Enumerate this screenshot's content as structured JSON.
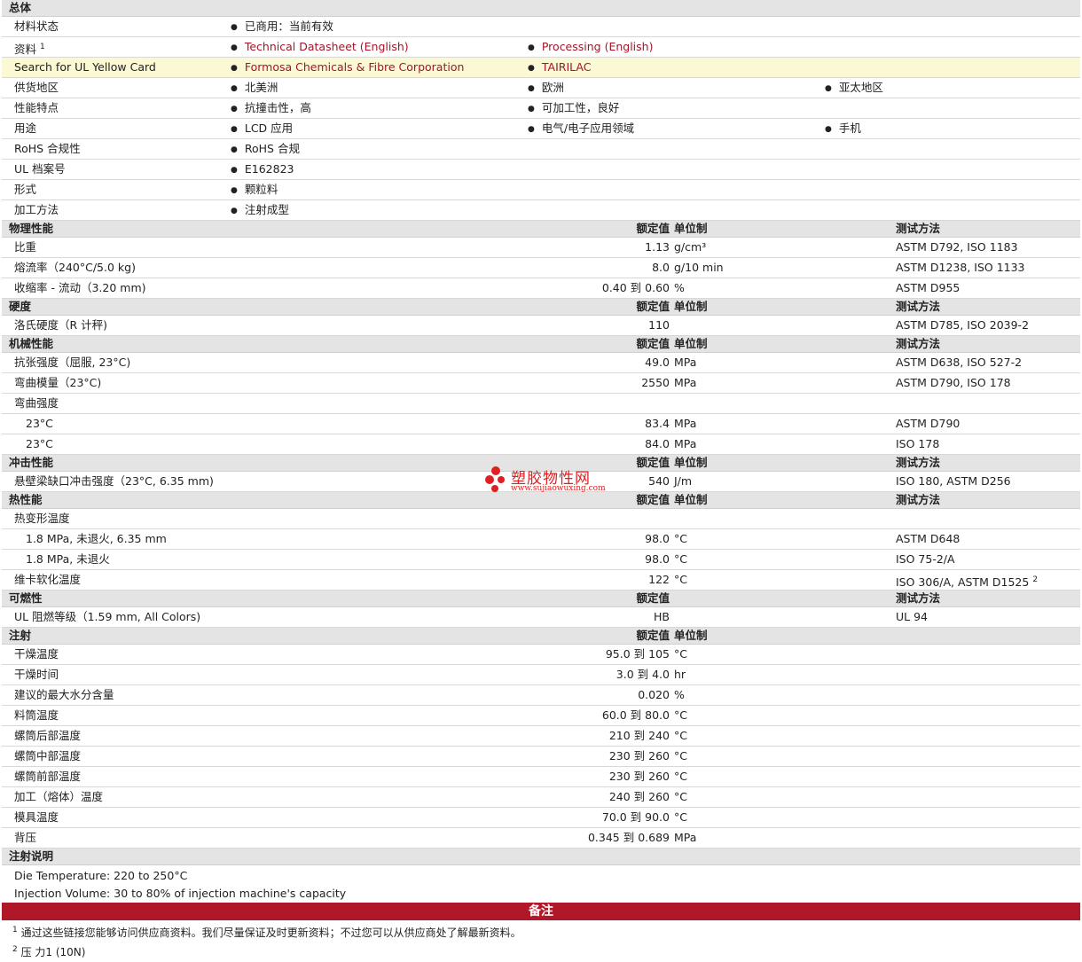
{
  "general": {
    "title": "总体",
    "rows": [
      {
        "label": "材料状态",
        "items": [
          "已商用：当前有效"
        ]
      },
      {
        "label": "资料",
        "sup": "1",
        "links": [
          "Technical Datasheet (English)",
          "Processing (English)"
        ]
      },
      {
        "label": "Search for UL Yellow Card",
        "links": [
          "Formosa Chemicals & Fibre Corporation",
          "TAIRILAC"
        ]
      },
      {
        "label": "供货地区",
        "items": [
          "北美洲",
          "欧洲",
          "亚太地区"
        ]
      },
      {
        "label": "性能特点",
        "items": [
          "抗撞击性，高",
          "可加工性，良好"
        ]
      },
      {
        "label": "用途",
        "items": [
          "LCD 应用",
          "电气/电子应用领域",
          "手机"
        ]
      },
      {
        "label": "RoHS 合规性",
        "items": [
          "RoHS 合规"
        ]
      },
      {
        "label": "UL 档案号",
        "items": [
          "E162823"
        ]
      },
      {
        "label": "形式",
        "items": [
          "颗粒料"
        ]
      },
      {
        "label": "加工方法",
        "items": [
          "注射成型"
        ]
      }
    ]
  },
  "headers": {
    "value": "额定值",
    "unit": "单位制",
    "test": "测试方法"
  },
  "physical": {
    "title": "物理性能",
    "rows": [
      {
        "label": "比重",
        "value": "1.13",
        "unit": "g/cm³",
        "test": "ASTM D792, ISO 1183"
      },
      {
        "label": "熔流率（240°C/5.0 kg)",
        "value": "8.0",
        "unit": "g/10 min",
        "test": "ASTM D1238, ISO 1133"
      },
      {
        "label": "收缩率 - 流动（3.20 mm)",
        "value": "0.40 到  0.60",
        "unit": "%",
        "test": "ASTM D955"
      }
    ]
  },
  "hardness": {
    "title": "硬度",
    "rows": [
      {
        "label": "洛氏硬度（R 计秤)",
        "value": "110",
        "unit": "",
        "test": "ASTM D785, ISO 2039-2"
      }
    ]
  },
  "mechanical": {
    "title": "机械性能",
    "rows": [
      {
        "label": "抗张强度（屈服, 23°C)",
        "value": "49.0",
        "unit": "MPa",
        "test": "ASTM D638, ISO 527-2"
      },
      {
        "label": "弯曲模量（23°C)",
        "value": "2550",
        "unit": "MPa",
        "test": "ASTM D790, ISO 178"
      },
      {
        "label": "弯曲强度",
        "value": "",
        "unit": "",
        "test": ""
      },
      {
        "label": "23°C",
        "value": "83.4",
        "unit": "MPa",
        "test": "ASTM D790",
        "indent": true
      },
      {
        "label": "23°C",
        "value": "84.0",
        "unit": "MPa",
        "test": "ISO 178",
        "indent": true
      }
    ]
  },
  "impact": {
    "title": "冲击性能",
    "rows": [
      {
        "label": "悬壁梁缺口冲击强度（23°C, 6.35 mm)",
        "value": "540",
        "unit": "J/m",
        "test": "ISO 180, ASTM D256"
      }
    ]
  },
  "thermal": {
    "title": "热性能",
    "rows": [
      {
        "label": "热变形温度",
        "value": "",
        "unit": "",
        "test": ""
      },
      {
        "label": "1.8 MPa, 未退火, 6.35 mm",
        "value": "98.0",
        "unit": "°C",
        "test": "ASTM D648",
        "indent": true
      },
      {
        "label": "1.8 MPa, 未退火",
        "value": "98.0",
        "unit": "°C",
        "test": "ISO 75-2/A",
        "indent": true
      },
      {
        "label": "维卡软化温度",
        "value": "122",
        "unit": "°C",
        "test": "ISO 306/A, ASTM D1525",
        "sup": "2"
      }
    ]
  },
  "flammability": {
    "title": "可燃性",
    "rows": [
      {
        "label": "UL 阻燃等级（1.59 mm, All Colors)",
        "value": "HB",
        "unit": "",
        "test": "UL 94"
      }
    ]
  },
  "injection": {
    "title": "注射",
    "rows": [
      {
        "label": "干燥温度",
        "value": "95.0 到  105",
        "unit": "°C"
      },
      {
        "label": "干燥时间",
        "value": "3.0 到  4.0",
        "unit": "hr"
      },
      {
        "label": "建议的最大水分含量",
        "value": "0.020",
        "unit": "%"
      },
      {
        "label": "料筒温度",
        "value": "60.0 到  80.0",
        "unit": "°C"
      },
      {
        "label": "螺筒后部温度",
        "value": "210 到  240",
        "unit": "°C"
      },
      {
        "label": "螺筒中部温度",
        "value": "230 到  260",
        "unit": "°C"
      },
      {
        "label": "螺筒前部温度",
        "value": "230 到  260",
        "unit": "°C"
      },
      {
        "label": "加工（熔体）温度",
        "value": "240 到  260",
        "unit": "°C"
      },
      {
        "label": "模具温度",
        "value": "70.0 到  90.0",
        "unit": "°C"
      },
      {
        "label": "背压",
        "value": "0.345 到  0.689",
        "unit": "MPa"
      }
    ]
  },
  "injection_notes": {
    "title": "注射说明",
    "lines": [
      "Die Temperature: 220 to 250°C",
      "Injection Volume: 30 to 80% of injection machine's capacity"
    ]
  },
  "remarks": {
    "title": "备注",
    "notes": [
      {
        "num": "1",
        "text": "通过这些链接您能够访问供应商资料。我们尽量保证及时更新资料；不过您可以从供应商处了解最新资料。"
      },
      {
        "num": "2",
        "text": "压  力1 (10N)"
      }
    ]
  },
  "watermark": {
    "name": "塑胶物性网",
    "url": "www.sujiaowuxing.com",
    "color": "#e02020"
  }
}
